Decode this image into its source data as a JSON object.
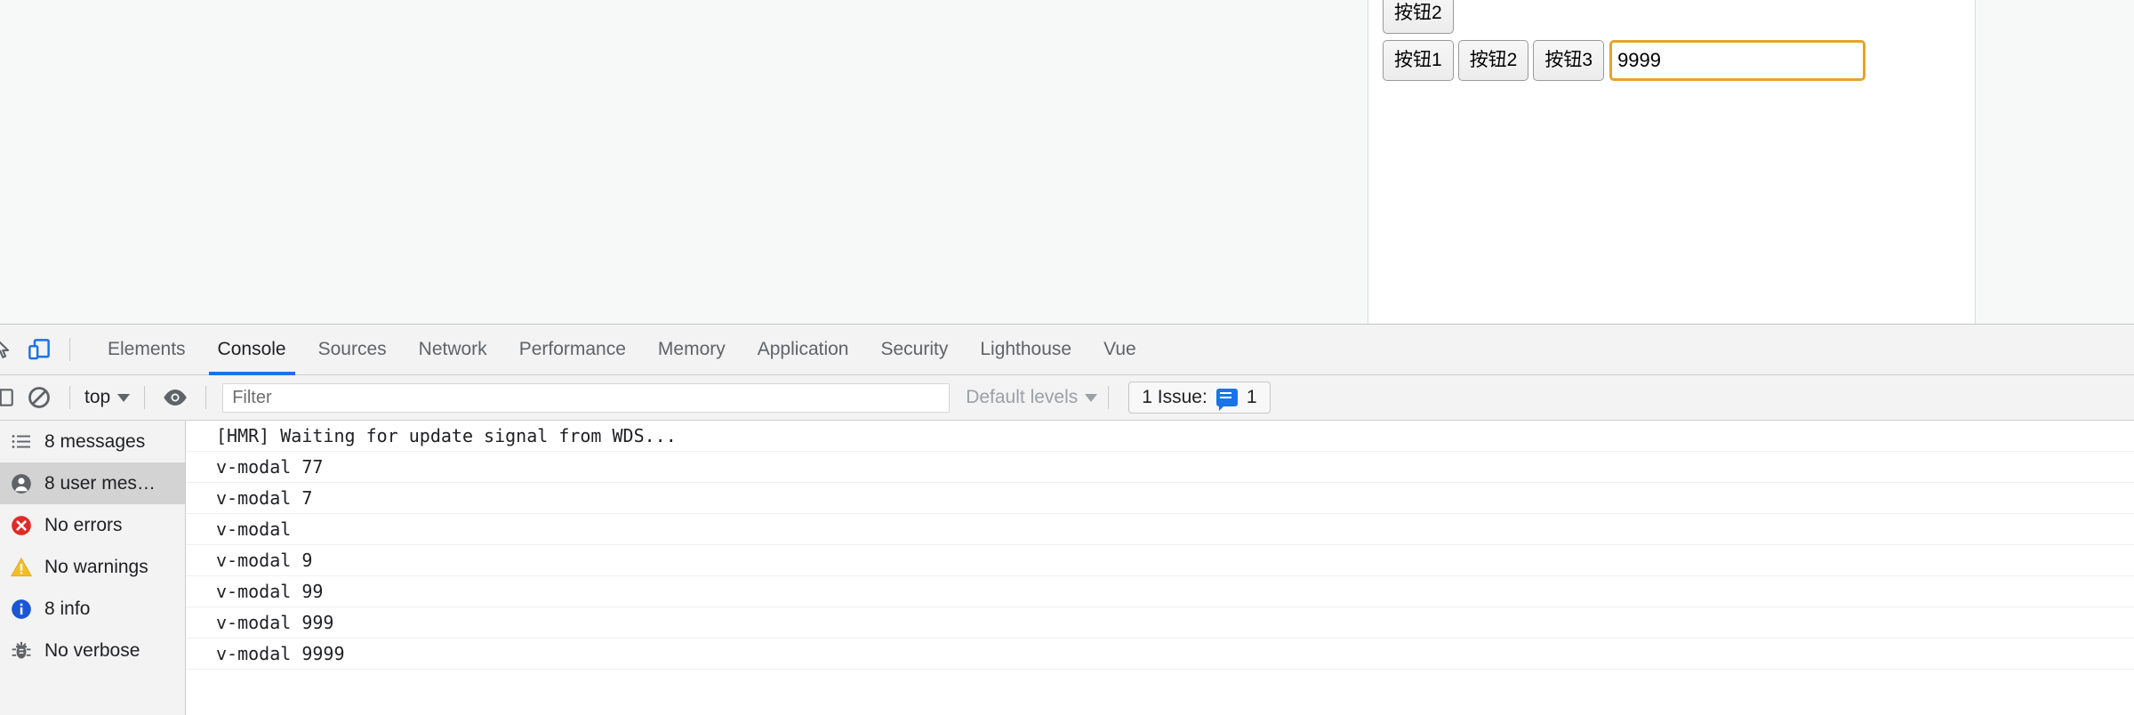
{
  "page": {
    "background_color": "#f7f8f8",
    "panel_background": "#ffffff",
    "buttons_row_top": [
      {
        "label": "按钮2",
        "name": "button-2-top"
      }
    ],
    "buttons_row_main": [
      {
        "label": "按钮1",
        "name": "button-1"
      },
      {
        "label": "按钮2",
        "name": "button-2"
      },
      {
        "label": "按钮3",
        "name": "button-3"
      }
    ],
    "number_input": {
      "value": "9999",
      "placeholder": "",
      "focus_color": "#e5a32b"
    }
  },
  "devtools": {
    "icons": {
      "inspect": "inspect-cursor-icon",
      "device_toolbar": "device-toolbar-icon",
      "clear_console": "clear-console-icon",
      "sidebar_toggle": "console-sidebar-toggle-icon",
      "eye": "live-expression-eye-icon"
    },
    "accent_color": "#1a73e8",
    "tabs": [
      {
        "label": "Elements",
        "active": false
      },
      {
        "label": "Console",
        "active": true
      },
      {
        "label": "Sources",
        "active": false
      },
      {
        "label": "Network",
        "active": false
      },
      {
        "label": "Performance",
        "active": false
      },
      {
        "label": "Memory",
        "active": false
      },
      {
        "label": "Application",
        "active": false
      },
      {
        "label": "Security",
        "active": false
      },
      {
        "label": "Lighthouse",
        "active": false
      },
      {
        "label": "Vue",
        "active": false
      }
    ],
    "console_toolbar": {
      "context": "top",
      "filter_placeholder": "Filter",
      "filter_value": "",
      "levels_label": "Default levels",
      "issues_label": "1 Issue:",
      "issues_count": "1"
    },
    "console_sidebar": [
      {
        "label": "8 messages",
        "icon": "list-icon",
        "selected": false
      },
      {
        "label": "8 user mes…",
        "icon": "user-icon",
        "selected": true
      },
      {
        "label": "No errors",
        "icon": "error-icon",
        "selected": false
      },
      {
        "label": "No warnings",
        "icon": "warning-icon",
        "selected": false
      },
      {
        "label": "8 info",
        "icon": "info-icon",
        "selected": false
      },
      {
        "label": "No verbose",
        "icon": "bug-icon",
        "selected": false
      }
    ],
    "console_messages": [
      {
        "text": "[HMR] Waiting for update signal from WDS..."
      },
      {
        "text": "v-modal 77"
      },
      {
        "text": "v-modal 7"
      },
      {
        "text": "v-modal"
      },
      {
        "text": "v-modal 9"
      },
      {
        "text": "v-modal 99"
      },
      {
        "text": "v-modal 999"
      },
      {
        "text": "v-modal 9999"
      }
    ]
  }
}
